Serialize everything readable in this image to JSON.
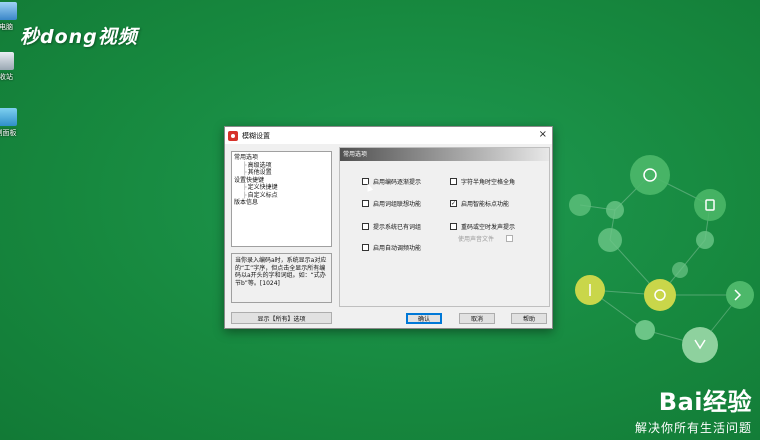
{
  "desktop": {
    "icons": [
      {
        "label": "电脑"
      },
      {
        "label": "收站"
      },
      {
        "label": "制面板"
      }
    ],
    "brand": "秒dong视频"
  },
  "watermark": {
    "main": "Bai经验",
    "paw": "du",
    "sub": "解决你所有生活问题"
  },
  "dialog": {
    "title": "模糊设置",
    "close": "×",
    "tree": [
      {
        "label": "常用选项",
        "level": 0
      },
      {
        "label": "高级选项",
        "level": 1
      },
      {
        "label": "其他设置",
        "level": 1
      },
      {
        "label": "设置快捷键",
        "level": 0
      },
      {
        "label": "定义快捷键",
        "level": 1
      },
      {
        "label": "自定义标点",
        "level": 1
      },
      {
        "label": "版本信息",
        "level": 0
      }
    ],
    "description": "当你录入编码a时，系统显示a对应的“工”字序，但点击全显示所有编码以a开头的字和词组。如：“式办节b”等。[1024]",
    "show_all_button": "显示【所有】选项",
    "group_header": "常用选项",
    "options": [
      {
        "label": "启用编码逐渐提示",
        "checked": false,
        "disabled": false
      },
      {
        "label": "字符半角时空格全角",
        "checked": false,
        "disabled": false
      },
      {
        "label": "启用词组联想功能",
        "checked": false,
        "disabled": false
      },
      {
        "label": "启用智能标点功能",
        "checked": true,
        "disabled": false
      },
      {
        "label": "提示系统已有词组",
        "checked": false,
        "disabled": false
      },
      {
        "label": "重码或空时发声提示",
        "checked": false,
        "disabled": false
      },
      {
        "label": "使用声音文件",
        "checked": false,
        "disabled": true
      },
      {
        "label": "启用自动调频功能",
        "checked": false,
        "disabled": false
      }
    ],
    "buttons": {
      "ok": "确认",
      "cancel": "取消",
      "help": "帮助"
    }
  }
}
